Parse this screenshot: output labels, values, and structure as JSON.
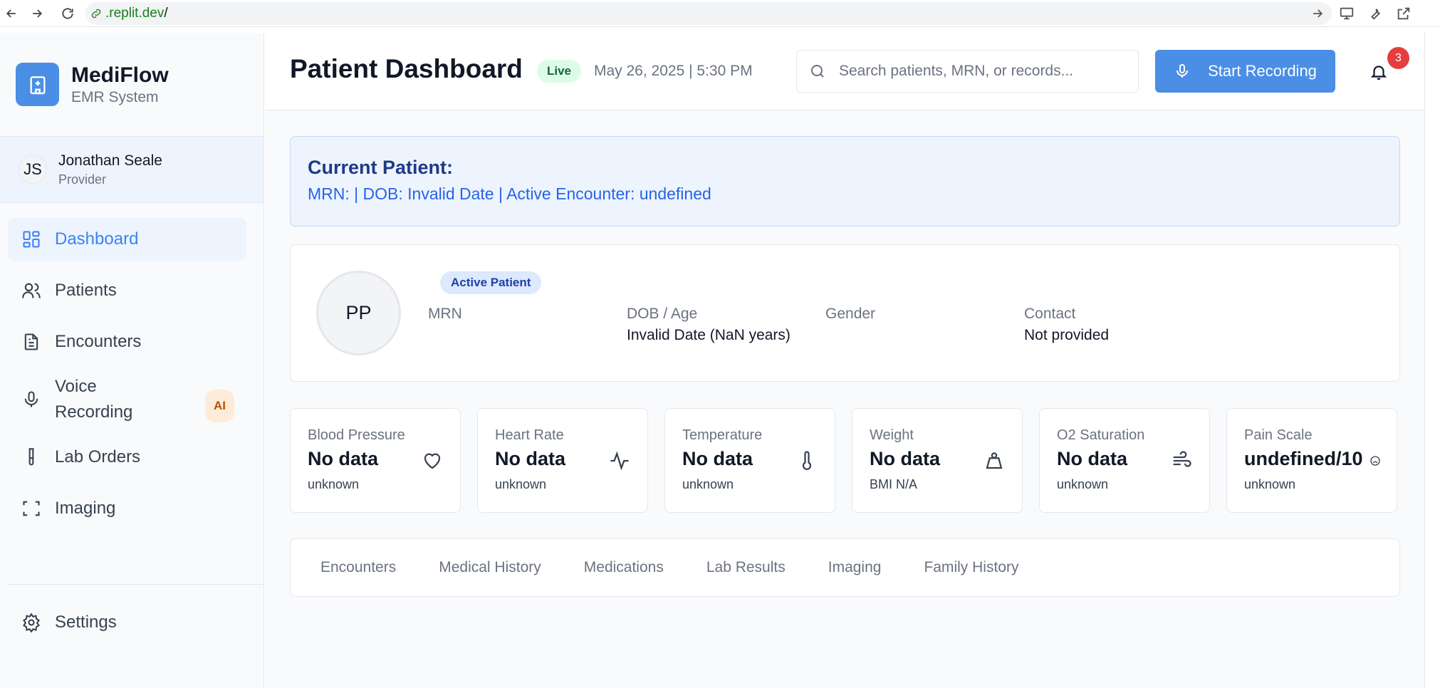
{
  "browser": {
    "url_prefix": ".replit.dev",
    "url_suffix": "/"
  },
  "brand": {
    "name": "MediFlow",
    "subtitle": "EMR System"
  },
  "user": {
    "initials": "JS",
    "name": "Jonathan Seale",
    "role": "Provider"
  },
  "nav": {
    "items": [
      {
        "label": "Dashboard",
        "icon": "dashboard-icon",
        "active": true
      },
      {
        "label": "Patients",
        "icon": "users-icon"
      },
      {
        "label": "Encounters",
        "icon": "document-icon"
      },
      {
        "label": "Voice Recording",
        "icon": "microphone-icon",
        "badge": "AI"
      },
      {
        "label": "Lab Orders",
        "icon": "test-tube-icon"
      },
      {
        "label": "Imaging",
        "icon": "scan-icon"
      }
    ],
    "settings_label": "Settings"
  },
  "header": {
    "title": "Patient Dashboard",
    "live_badge": "Live",
    "datetime": "May 26, 2025 | 5:30 PM",
    "search_placeholder": "Search patients, MRN, or records...",
    "record_button": "Start Recording",
    "notification_count": "3"
  },
  "current_patient": {
    "title": "Current Patient:",
    "details": "MRN: | DOB: Invalid Date | Active Encounter: undefined"
  },
  "patient": {
    "initials": "PP",
    "status_badge": "Active Patient",
    "fields": [
      {
        "label": "MRN",
        "value": ""
      },
      {
        "label": "DOB / Age",
        "value": "Invalid Date (NaN years)"
      },
      {
        "label": "Gender",
        "value": ""
      },
      {
        "label": "Contact",
        "value": "Not provided"
      }
    ]
  },
  "vitals": [
    {
      "label": "Blood Pressure",
      "value": "No data",
      "sub": "unknown",
      "icon": "heart-icon"
    },
    {
      "label": "Heart Rate",
      "value": "No data",
      "sub": "unknown",
      "icon": "pulse-icon"
    },
    {
      "label": "Temperature",
      "value": "No data",
      "sub": "unknown",
      "icon": "thermometer-icon"
    },
    {
      "label": "Weight",
      "value": "No data",
      "sub": "BMI N/A",
      "icon": "weight-icon"
    },
    {
      "label": "O2 Saturation",
      "value": "No data",
      "sub": "unknown",
      "icon": "wind-icon"
    },
    {
      "label": "Pain Scale",
      "value": "undefined/10",
      "sub": "unknown",
      "icon": "face-icon"
    }
  ],
  "tabs": [
    "Encounters",
    "Medical History",
    "Medications",
    "Lab Results",
    "Imaging",
    "Family History"
  ],
  "colors": {
    "accent": "#4a8ee6",
    "live": "#dcfce7",
    "alert": "#e53e3e"
  }
}
